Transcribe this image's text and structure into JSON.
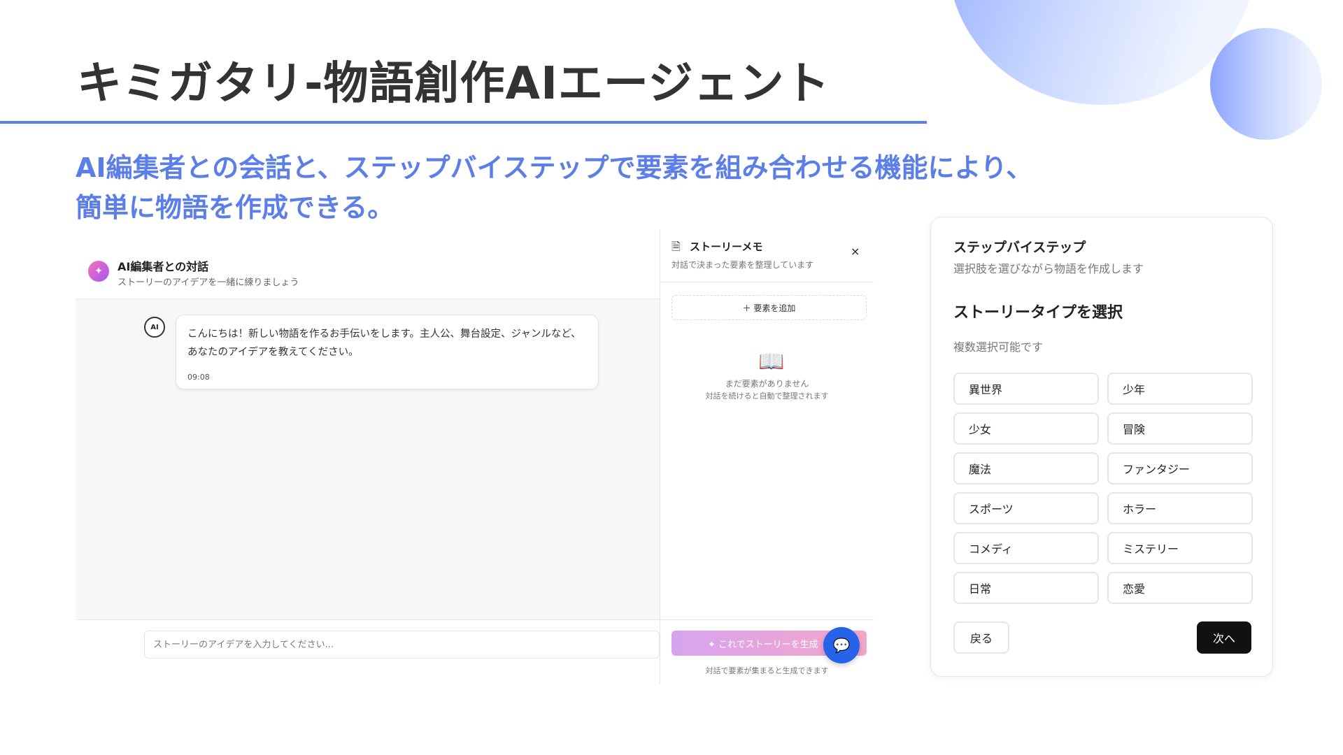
{
  "slide": {
    "title": "キミガタリ-物語創作AIエージェント",
    "subtitle_line1": "AI編集者との会話と、ステップバイステップで要素を組み合わせる機能により、",
    "subtitle_line2": "簡単に物語を作成できる。"
  },
  "chat": {
    "header_title": "AI編集者との対話",
    "header_subtitle": "ストーリーのアイデアを一緒に練りましょう",
    "message_text": "こんにちは！新しい物語を作るお手伝いをします。主人公、舞台設定、ジャンルなど、あなたのアイデアを教えてください。",
    "message_time": "09:08",
    "bot_avatar_label": "AI",
    "input_placeholder": "ストーリーのアイデアを入力してください..."
  },
  "memo": {
    "title": "ストーリーメモ",
    "subtitle": "対話で決まった要素を整理しています",
    "close_glyph": "×",
    "add_label": "＋ 要素を追加",
    "empty_title": "まだ要素がありません",
    "empty_sub": "対話を続けると自動で整理されます",
    "generate_label": "これでストーリーを生成",
    "generate_note": "対話で要素が集まると生成できます"
  },
  "step": {
    "title": "ステップバイステップ",
    "subtitle": "選択肢を選びながら物語を作成します",
    "section_title": "ストーリータイプを選択",
    "section_note": "複数選択可能です",
    "options": [
      "異世界",
      "少年",
      "少女",
      "冒険",
      "魔法",
      "ファンタジー",
      "スポーツ",
      "ホラー",
      "コメディ",
      "ミステリー",
      "日常",
      "恋愛"
    ],
    "back_label": "戻る",
    "next_label": "次へ"
  },
  "icons": {
    "sparkle": "sparkle-icon",
    "document": "document-icon",
    "book": "book-icon",
    "chat_bubble": "chat-bubble-icon"
  },
  "colors": {
    "accent": "#5b7ee8",
    "fab": "#2563eb",
    "next_button": "#111111"
  }
}
